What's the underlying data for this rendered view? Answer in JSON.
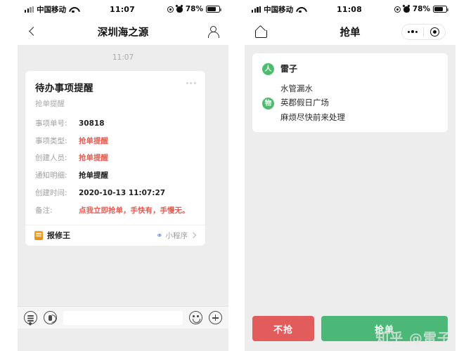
{
  "left_phone": {
    "status_bar": {
      "carrier": "中国移动",
      "time": "11:07",
      "battery_percent": "78%"
    },
    "nav": {
      "title": "深圳海之源",
      "back_icon": "chevron-left-icon",
      "contact_icon": "contact-person-icon"
    },
    "chat": {
      "timestamp": "11:07",
      "card": {
        "title": "待办事项提醒",
        "subtitle": "抢单提醒",
        "more_icon": "more-dots-icon",
        "rows": [
          {
            "label": "事项单号:",
            "value": "30818",
            "color": "#1f1f1f"
          },
          {
            "label": "事项类型:",
            "value": "抢单提醒",
            "color": "#e35d52"
          },
          {
            "label": "创建人员:",
            "value": "抢单提醒",
            "color": "#e35d52"
          },
          {
            "label": "通知明细:",
            "value": "抢单提醒",
            "color": "#1f1f1f"
          },
          {
            "label": "创建时间:",
            "value": "2020-10-13 11:07:27",
            "color": "#1f1f1f"
          },
          {
            "label": "备注:",
            "value": "点我立即抢单，手快有，手慢无。",
            "color": "#e35d52"
          }
        ],
        "footer": {
          "app_name": "报修王",
          "tag": "小程序",
          "app_icon": "miniprogram-app-icon",
          "chevron_icon": "chevron-right-icon"
        }
      }
    },
    "input_bar": {
      "menu_icon": "chat-menu-icon",
      "voice_icon": "voice-input-icon",
      "text_value": "",
      "text_placeholder": "",
      "emoji_icon": "emoji-smile-icon",
      "plus_icon": "plus-more-icon"
    }
  },
  "right_phone": {
    "status_bar": {
      "carrier": "中国移动",
      "time": "11:08",
      "battery_percent": "78%"
    },
    "nav": {
      "title": "抢单",
      "home_icon": "home-icon",
      "more_icon": "more-dots-icon",
      "capsule_icon": "capsule-target-icon"
    },
    "order_card": {
      "person_badge": "人",
      "person_name": "雷子",
      "item_badge": "物",
      "details": [
        "水管漏水",
        "英郡假日广场",
        "麻烦尽快前来处理"
      ]
    },
    "actions": {
      "refuse_label": "不抢",
      "accept_label": "抢单",
      "refuse_color": "#e35c5c",
      "accept_color": "#4cb878"
    },
    "watermark": "知乎 @雷子"
  }
}
